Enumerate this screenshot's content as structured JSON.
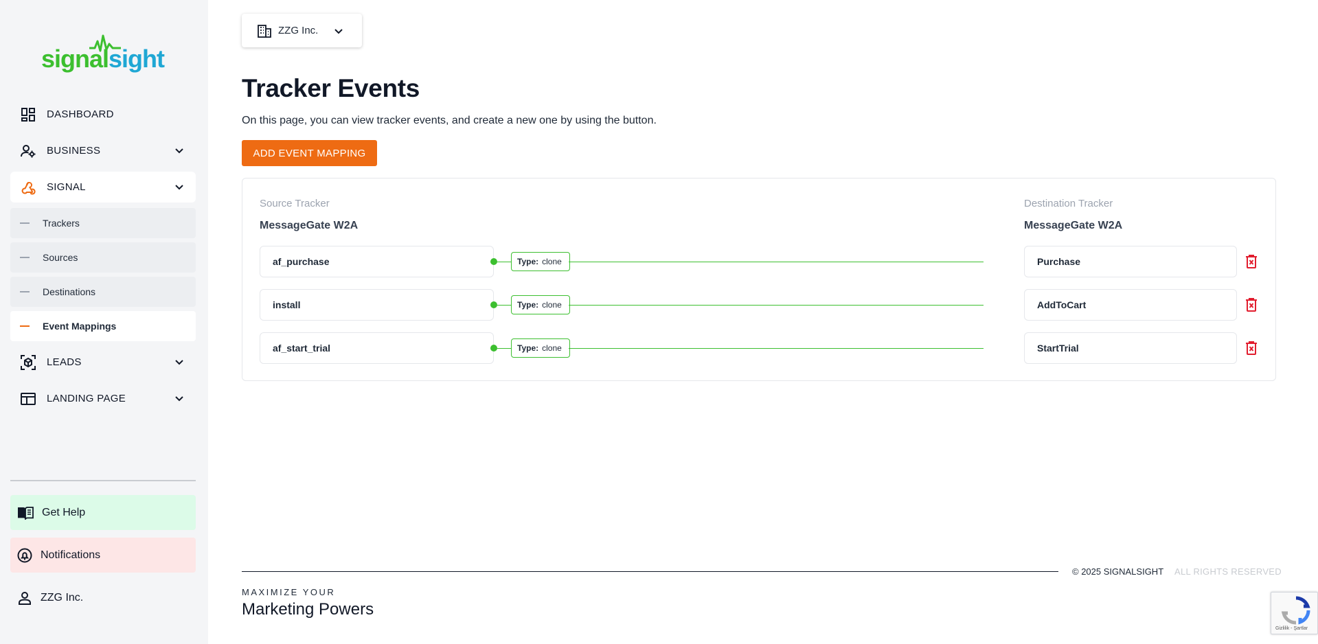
{
  "sidebar": {
    "logo": {
      "part1": "signal",
      "part2": "sight",
      "colors": {
        "signal": "#3cbf2f",
        "sight": "#1fa7d4"
      }
    },
    "nav": [
      {
        "label": "DASHBOARD",
        "icon": "dashboard-icon"
      },
      {
        "label": "BUSINESS",
        "icon": "user-gear-icon",
        "expandable": true
      },
      {
        "label": "SIGNAL",
        "icon": "webhook-icon",
        "expandable": true,
        "active": true
      },
      {
        "label": "LEADS",
        "icon": "cube-scan-icon",
        "expandable": true
      },
      {
        "label": "LANDING PAGE",
        "icon": "browser-window-icon",
        "expandable": true
      }
    ],
    "signal_sub": [
      {
        "label": "Trackers"
      },
      {
        "label": "Sources"
      },
      {
        "label": "Destinations"
      },
      {
        "label": "Event Mappings",
        "active": true
      }
    ],
    "help_label": "Get Help",
    "notifications_label": "Notifications",
    "user_label": "ZZG Inc."
  },
  "org_selector": {
    "label": "ZZG Inc."
  },
  "page": {
    "title": "Tracker Events",
    "description": "On this page, you can view tracker events, and create a new one by using the button.",
    "add_button": "ADD EVENT MAPPING"
  },
  "mapping": {
    "source_heading": "Source Tracker",
    "source_name": "MessageGate W2A",
    "destination_heading": "Destination Tracker",
    "destination_name": "MessageGate W2A",
    "type_key": "Type:",
    "rows": [
      {
        "source": "af_purchase",
        "type": "clone",
        "destination": "Purchase"
      },
      {
        "source": "install",
        "type": "clone",
        "destination": "AddToCart"
      },
      {
        "source": "af_start_trial",
        "type": "clone",
        "destination": "StartTrial"
      }
    ]
  },
  "footer": {
    "copyright": "© 2025 SIGNALSIGHT",
    "rights": "ALL RIGHTS RESERVED",
    "tagline_small": "MAXIMIZE YOUR",
    "tagline_large": "Marketing Powers"
  },
  "recaptcha": {
    "text": "Gizlilik - Şartlar"
  },
  "colors": {
    "accent": "#ee6b13",
    "connector": "#3cbf2f",
    "delete": "#e11d2e"
  }
}
